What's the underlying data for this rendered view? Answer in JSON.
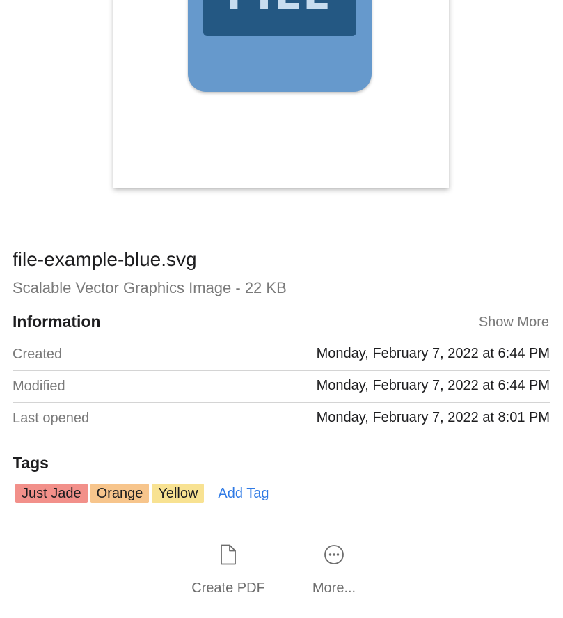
{
  "preview": {
    "graphic_text": "FILE"
  },
  "file": {
    "name": "file-example-blue.svg",
    "kind": "Scalable Vector Graphics Image - 22 KB"
  },
  "information": {
    "title": "Information",
    "show_more_label": "Show More",
    "rows": [
      {
        "label": "Created",
        "value": "Monday, February 7, 2022 at 6:44 PM"
      },
      {
        "label": "Modified",
        "value": "Monday, February 7, 2022 at 6:44 PM"
      },
      {
        "label": "Last opened",
        "value": "Monday, February 7, 2022 at 8:01 PM"
      }
    ]
  },
  "tags": {
    "title": "Tags",
    "items": [
      {
        "label": "Just Jade",
        "color": "#f2908a"
      },
      {
        "label": "Orange",
        "color": "#f7c58c"
      },
      {
        "label": "Yellow",
        "color": "#f8e292"
      }
    ],
    "add_label": "Add Tag"
  },
  "actions": [
    {
      "label": "Create PDF",
      "icon": "document-icon"
    },
    {
      "label": "More...",
      "icon": "ellipsis-circle-icon"
    }
  ],
  "colors": {
    "accent": "#2f7ae5",
    "file_graphic_light": "#6699cc",
    "file_graphic_dark": "#245883"
  }
}
